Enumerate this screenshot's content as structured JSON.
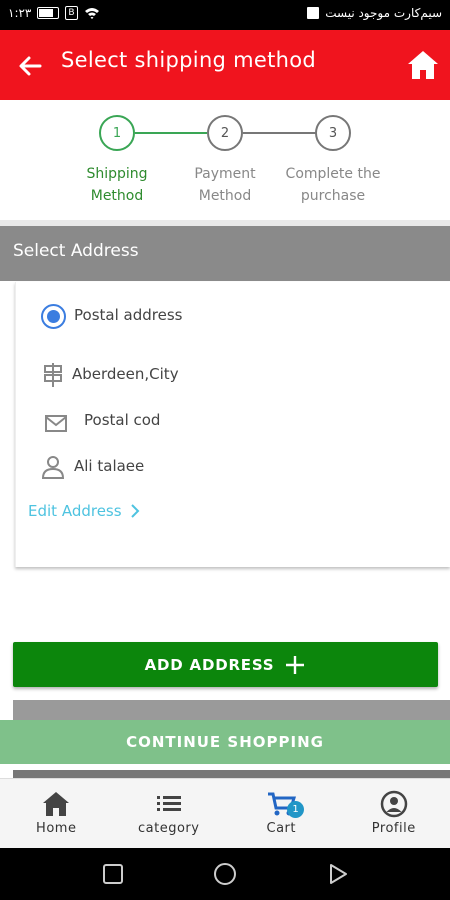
{
  "status_bar": {
    "time": "۱:۲۳",
    "carrier_text": "سیم‌کارت موجود نیست",
    "wifi_badge": "W",
    "b_badge": "B"
  },
  "header": {
    "title": "Select shipping method",
    "background": "#f0141e"
  },
  "stepper": {
    "steps": [
      {
        "number": "1",
        "label_line1": "Shipping",
        "label_line2": "Method",
        "active": true
      },
      {
        "number": "2",
        "label_line1": "Payment",
        "label_line2": "Method",
        "active": false
      },
      {
        "number": "3",
        "label_line1": "Complete the",
        "label_line2": "purchase",
        "active": false
      }
    ],
    "active_color": "#3aa655"
  },
  "section": {
    "title": "Select Address"
  },
  "address": {
    "type_label": "Postal address",
    "city": "Aberdeen,City",
    "postal_code": "Postal cod",
    "name": "Ali talaee",
    "edit_label": "Edit Address"
  },
  "buttons": {
    "add_address": "ADD ADDRESS",
    "continue": "CONTINUE SHOPPING",
    "add_color": "#0c860c",
    "continue_color": "#7fc18a"
  },
  "bottom_nav": {
    "items": [
      {
        "label": "Home",
        "icon": "home-icon"
      },
      {
        "label": "category",
        "icon": "list-icon"
      },
      {
        "label": "Cart",
        "icon": "cart-icon",
        "badge": "1"
      },
      {
        "label": "Profile",
        "icon": "profile-icon"
      }
    ]
  }
}
